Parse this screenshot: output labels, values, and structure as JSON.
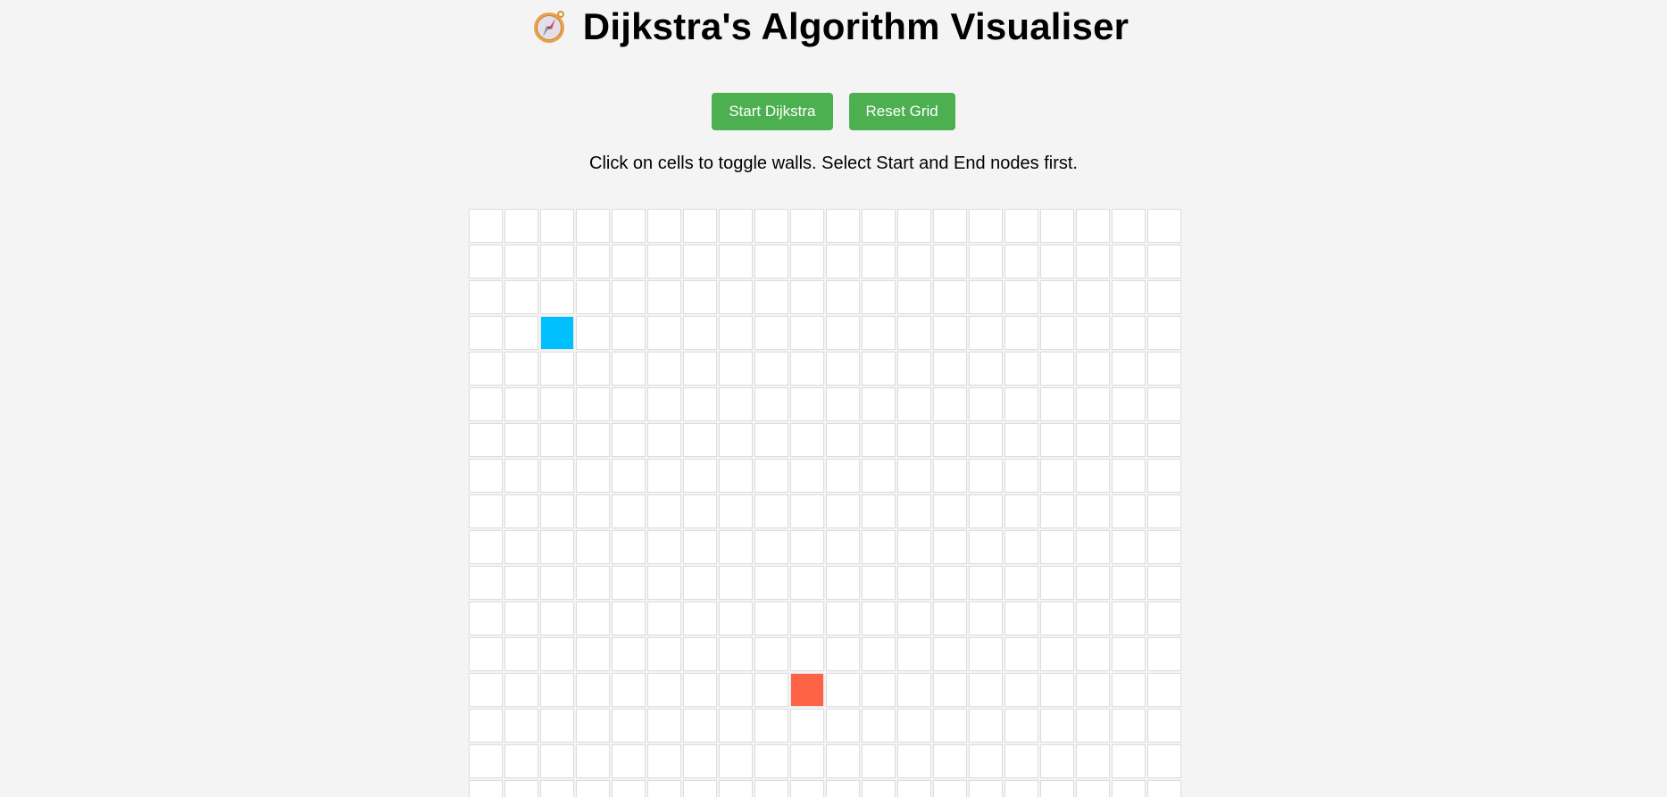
{
  "header": {
    "title": "Dijkstra's Algorithm Visualiser",
    "icon": "compass-icon"
  },
  "controls": {
    "start_label": "Start Dijkstra",
    "reset_label": "Reset Grid",
    "button_color": "#4caf50"
  },
  "instructions": "Click on cells to toggle walls. Select Start and End nodes first.",
  "grid": {
    "columns": 20,
    "visible_rows": 17,
    "start_node": {
      "row": 3,
      "col": 2,
      "color": "#00bfff"
    },
    "end_node": {
      "row": 13,
      "col": 9,
      "color": "#ff6347"
    },
    "walls": []
  }
}
